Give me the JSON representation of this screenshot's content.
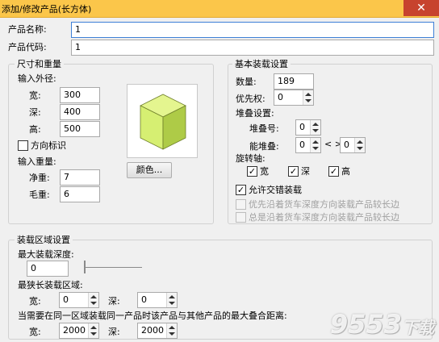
{
  "window": {
    "title": "添加/修改产品(长方体)",
    "close": "✕"
  },
  "product": {
    "name_label": "产品名称:",
    "name_value": "1",
    "code_label": "产品代码:",
    "code_value": "1"
  },
  "size_weight": {
    "title": "尺寸和重量",
    "dims_label": "输入外径:",
    "width_label": "宽:",
    "width_value": "300",
    "depth_label": "深:",
    "depth_value": "400",
    "height_label": "高:",
    "height_value": "500",
    "orient_label": "方向标识",
    "weight_label": "输入重量:",
    "net_label": "净重:",
    "net_value": "7",
    "gross_label": "毛重:",
    "gross_value": "6",
    "color_button": "颜色..."
  },
  "basic": {
    "title": "基本装载设置",
    "quantity_label": "数量:",
    "quantity_value": "189",
    "priority_label": "优先权:",
    "priority_value": "0",
    "stack_settings_label": "堆叠设置:",
    "stack_no_label": "堆叠号:",
    "stack_no_value": "0",
    "can_stack_label": "能堆叠:",
    "can_stack_from": "0",
    "range_sep": "< >",
    "can_stack_to": "0",
    "rotation_label": "旋转轴:",
    "rot_width": "宽",
    "rot_depth": "深",
    "rot_height": "高",
    "allow_mixed": "允许交错装载",
    "prefer_long_depth": "优先沿着货车深度方向装载产品较长边",
    "always_long_depth": "总是沿着货车深度方向装载产品较长边"
  },
  "load_area": {
    "title": "装载区域设置",
    "max_depth_label": "最大装载深度:",
    "max_depth_value": "0",
    "min_len_label": "最狭长装载区域:",
    "min_width_label": "宽:",
    "min_width_value": "0",
    "min_depth_label": "深:",
    "min_depth_value": "0",
    "overlap_label": "当需要在同一区域装载同一产品时该产品与其他产品的最大叠合距离:",
    "ov_width_label": "宽:",
    "ov_width_value": "2000",
    "ov_depth_label": "深:",
    "ov_depth_value": "2000"
  },
  "watermark": {
    "main": "9553",
    "sub": "下载"
  },
  "colors": {
    "cube_front": "#d6ef72",
    "cube_top": "#e4f58f",
    "cube_side": "#aecb47",
    "titlebar": "#fbc64a"
  }
}
